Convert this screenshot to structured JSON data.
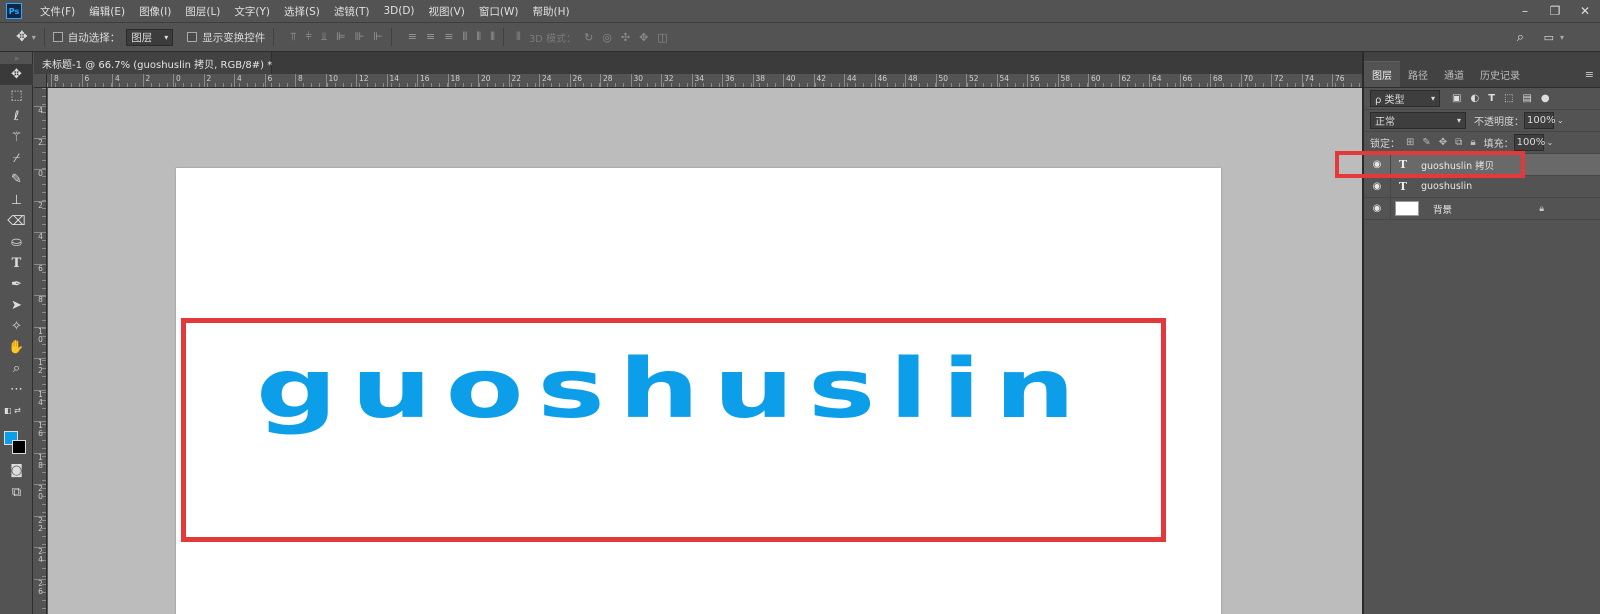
{
  "app": {
    "logo": "Ps",
    "menu": [
      "文件(F)",
      "编辑(E)",
      "图像(I)",
      "图层(L)",
      "文字(Y)",
      "选择(S)",
      "滤镜(T)",
      "3D(D)",
      "视图(V)",
      "窗口(W)",
      "帮助(H)"
    ],
    "window_controls": [
      "–",
      "❐",
      "✕"
    ]
  },
  "options_bar": {
    "auto_select_label": "自动选择：",
    "auto_select_value": "图层",
    "show_transform_label": "显示变换控件",
    "mode_3d_label": "3D 模式："
  },
  "document_tab": {
    "title": "未标题-1 @ 66.7% (guoshuslin 拷贝, RGB/8#) *",
    "close": "×"
  },
  "rulers": {
    "horizontal": [
      "8",
      "6",
      "4",
      "2",
      "0",
      "2",
      "4",
      "6",
      "8",
      "10",
      "12",
      "14",
      "16",
      "18",
      "20",
      "22",
      "24",
      "26",
      "28",
      "30",
      "32",
      "34",
      "36",
      "38",
      "40",
      "42",
      "44",
      "46",
      "48",
      "50",
      "52",
      "54",
      "56",
      "58",
      "60",
      "62",
      "64",
      "66",
      "68",
      "70",
      "72",
      "74",
      "76"
    ],
    "vertical": [
      "4",
      "2",
      "0",
      "2",
      "4",
      "6",
      "8",
      "1 0",
      "1 2",
      "1 4",
      "1 6",
      "1 8",
      "2 0",
      "2 2",
      "2 4",
      "2 6"
    ]
  },
  "canvas": {
    "text": "guoshuslin",
    "text_color": "#0c9ee8",
    "highlight_color": "#e3393a"
  },
  "layers_panel": {
    "tabs": [
      "图层",
      "路径",
      "通道",
      "历史记录"
    ],
    "filter_label": "ρ 类型",
    "blend_mode": "正常",
    "opacity_label": "不透明度：",
    "opacity_value": "100%",
    "lock_label": "锁定：",
    "fill_label": "填充：",
    "fill_value": "100%",
    "layers": [
      {
        "name": "guoshuslin 拷贝",
        "type": "text",
        "selected": true
      },
      {
        "name": "guoshuslin",
        "type": "text",
        "selected": false
      },
      {
        "name": "背景",
        "type": "background",
        "selected": false,
        "locked": true
      }
    ]
  }
}
